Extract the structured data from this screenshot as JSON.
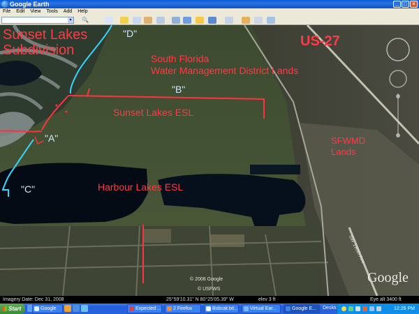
{
  "window": {
    "title": "Google Earth",
    "controls": [
      "_",
      "□",
      "×"
    ]
  },
  "menu": [
    "File",
    "Edit",
    "View",
    "Tools",
    "Add",
    "Help"
  ],
  "map_labels": {
    "sunset_lakes_subdivision_1": "Sunset Lakes",
    "sunset_lakes_subdivision_2": "Subdivision",
    "d": "\"D\"",
    "us27": "US-27",
    "sfwmd_district_1": "South Florida",
    "sfwmd_district_2": "Water Management District Lands",
    "b": "\"B\"",
    "sunset_lakes_esl": "Sunset Lakes ESL",
    "a": "\"A\"",
    "sfwmd_lands_1": "SFWMD",
    "sfwmd_lands_2": "Lands",
    "c": "\"C\"",
    "harbour_lakes_esl": "Harbour Lakes ESL",
    "copyright_google": "© 2008 Google",
    "usfws": "© USFWS",
    "google_logo": "Google",
    "road": "SW 196th Ave"
  },
  "status": {
    "imagery_date": "Imagery Date: Dec 31, 2008",
    "coords": "25°59'10.31\" N   80°25'05.39\" W",
    "elev": "elev   3 ft",
    "eye_alt": "Eye alt   3400 ft"
  },
  "taskbar": {
    "start": "Start",
    "items": [
      {
        "label": "Google",
        "active": false
      },
      {
        "label": "Expected ...",
        "active": false
      },
      {
        "label": "2 Firefox",
        "active": false
      },
      {
        "label": "Bobcat.txt...",
        "active": false
      },
      {
        "label": "Virtual Ear...",
        "active": false
      },
      {
        "label": "Google E...",
        "active": true
      }
    ],
    "desktop": "Desktop",
    "clock": "12:26 PM"
  }
}
